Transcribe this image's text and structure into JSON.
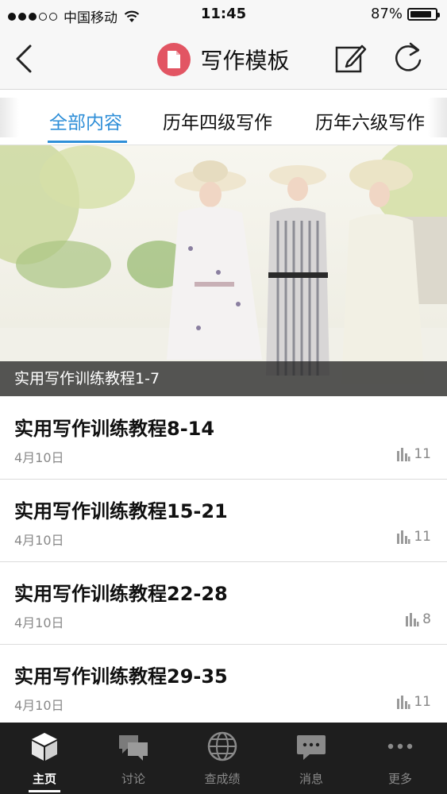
{
  "status_bar": {
    "carrier": "中国移动",
    "time": "11:45",
    "battery": "87%",
    "battery_level": 0.87,
    "signal_bars_filled": 3,
    "signal_bars_total": 5
  },
  "nav": {
    "title": "写作模板",
    "icon_color": "#e25563"
  },
  "tabs": [
    {
      "label": "全部内容",
      "active": true
    },
    {
      "label": "历年四级写作",
      "active": false
    },
    {
      "label": "历年六级写作",
      "active": false
    }
  ],
  "hero": {
    "caption": "实用写作训练教程1-7"
  },
  "articles": [
    {
      "title": "实用写作训练教程8-14",
      "date": "4月10日",
      "count": "11"
    },
    {
      "title": "实用写作训练教程15-21",
      "date": "4月10日",
      "count": "11"
    },
    {
      "title": "实用写作训练教程22-28",
      "date": "4月10日",
      "count": "8"
    },
    {
      "title": "实用写作训练教程29-35",
      "date": "4月10日",
      "count": "11"
    }
  ],
  "tabbar": [
    {
      "label": "主页",
      "icon": "cube-icon",
      "active": true
    },
    {
      "label": "讨论",
      "icon": "chat-bubbles-icon",
      "active": false
    },
    {
      "label": "查成绩",
      "icon": "globe-icon",
      "active": false
    },
    {
      "label": "消息",
      "icon": "message-icon",
      "active": false
    },
    {
      "label": "更多",
      "icon": "more-dots-icon",
      "active": false
    }
  ],
  "colors": {
    "accent": "#2f8fd8",
    "tabbar_bg": "#1e1e1e"
  }
}
